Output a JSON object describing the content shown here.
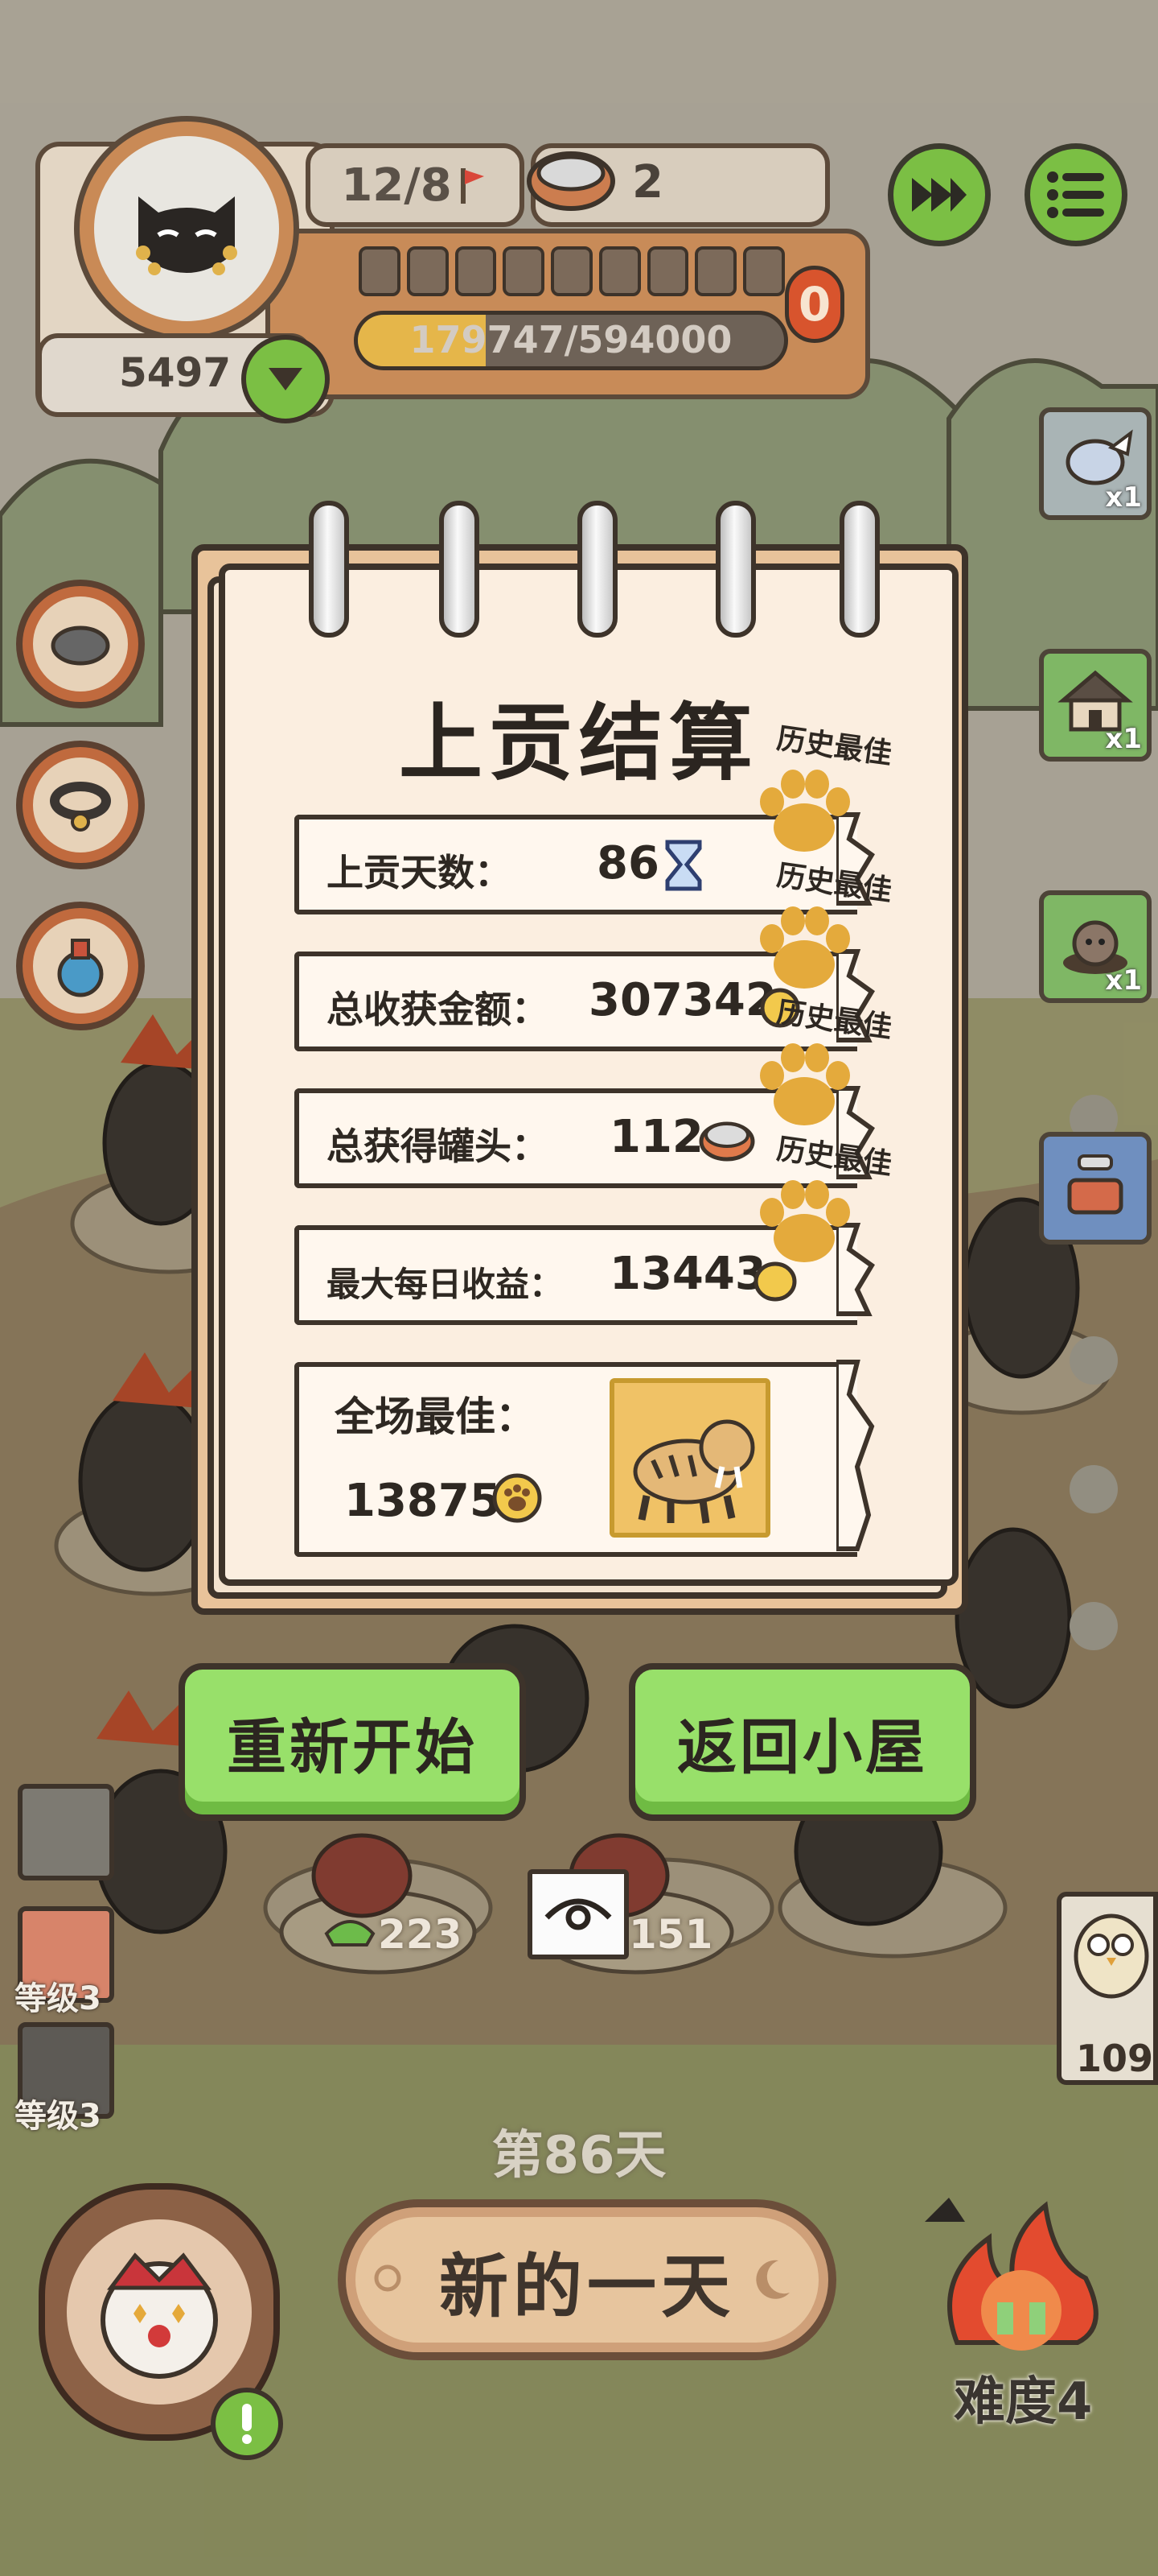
{
  "hud": {
    "level_count": "12/8",
    "can_count": "2",
    "coins": "5497",
    "progress_text": "179747/594000",
    "progress_fraction": 0.3,
    "slot_count": 0
  },
  "side_items": [
    {
      "icon": "winged-tin-icon",
      "count": "x1"
    },
    {
      "icon": "house-icon",
      "count": "x1"
    },
    {
      "icon": "mole-icon",
      "count": "x1"
    },
    {
      "icon": "sink-icon",
      "count": ""
    }
  ],
  "modal": {
    "title": "上贡结算",
    "best_label": "历史最佳",
    "rows": [
      {
        "label": "上贡天数：",
        "value": "86",
        "icon": "hourglass-icon"
      },
      {
        "label": "总收获金额：",
        "value": "307342",
        "icon": "coin-icon"
      },
      {
        "label": "总获得罐头：",
        "value": "112",
        "icon": "can-icon"
      },
      {
        "label": "最大每日收益：",
        "value": "13443",
        "icon": "coin-icon"
      }
    ],
    "overall_label": "全场最佳：",
    "overall_value": "13875",
    "restart_label": "重新开始",
    "return_label": "返回小屋"
  },
  "field": {
    "meat_left": "223",
    "meat_right": "151",
    "levels": [
      "等级3",
      "等级3"
    ],
    "right_counter": "109"
  },
  "bottom": {
    "day_label": "第86天",
    "new_day_label": "新的一天",
    "difficulty": "难度4"
  },
  "colors": {
    "green_button": "#98e06a",
    "paper": "#fbeee0",
    "notebook": "#e8c39a",
    "outline": "#3d332a",
    "paw": "#e4aa3c"
  }
}
